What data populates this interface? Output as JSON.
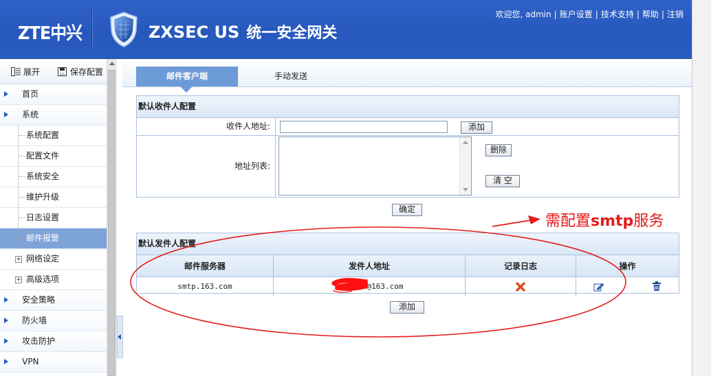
{
  "header": {
    "brand": "ZTE中兴",
    "product_name": "ZXSEC US",
    "product_cn": "统一安全网关",
    "links": [
      "欢迎您, admin",
      "账户设置",
      "技术支持",
      "帮助",
      "注销"
    ]
  },
  "sidebar": {
    "tools": {
      "expand": "展开",
      "save_config": "保存配置"
    },
    "items": [
      {
        "label": "首页",
        "type": "top"
      },
      {
        "label": "系统",
        "type": "top"
      },
      {
        "label": "系统配置",
        "type": "sub"
      },
      {
        "label": "配置文件",
        "type": "sub"
      },
      {
        "label": "系统安全",
        "type": "sub"
      },
      {
        "label": "维护升级",
        "type": "sub"
      },
      {
        "label": "日志设置",
        "type": "sub"
      },
      {
        "label": "邮件报警",
        "type": "sub",
        "active": true
      },
      {
        "label": "网络设定",
        "type": "sub-plus"
      },
      {
        "label": "高级选项",
        "type": "sub-plus"
      },
      {
        "label": "安全策略",
        "type": "top"
      },
      {
        "label": "防火墙",
        "type": "top"
      },
      {
        "label": "攻击防护",
        "type": "top"
      },
      {
        "label": "VPN",
        "type": "top"
      }
    ]
  },
  "tabs": [
    {
      "label": "邮件客户端",
      "active": true
    },
    {
      "label": "手动发送",
      "active": false
    }
  ],
  "recipient_panel": {
    "title": "默认收件人配置",
    "address_label": "收件人地址:",
    "address_value": "",
    "add_button": "添加",
    "list_label": "地址列表:",
    "delete_button": "删除",
    "clear_button": "清 空",
    "confirm_button": "确定"
  },
  "sender_panel": {
    "title": "默认发件人配置",
    "columns": [
      "邮件服务器",
      "发件人地址",
      "记录日志",
      "操作"
    ],
    "rows": [
      {
        "server": "smtp.163.com",
        "sender": "@163.com"
      }
    ],
    "add_button": "添加"
  },
  "annotation": {
    "text_prefix": "需配置",
    "text_bold": "smtp",
    "text_suffix": "服务",
    "color": "#e31b1b"
  },
  "colors": {
    "header": "#2a5cbf",
    "active_tab": "#6d9bd7",
    "active_menu": "#7ea3d6"
  }
}
